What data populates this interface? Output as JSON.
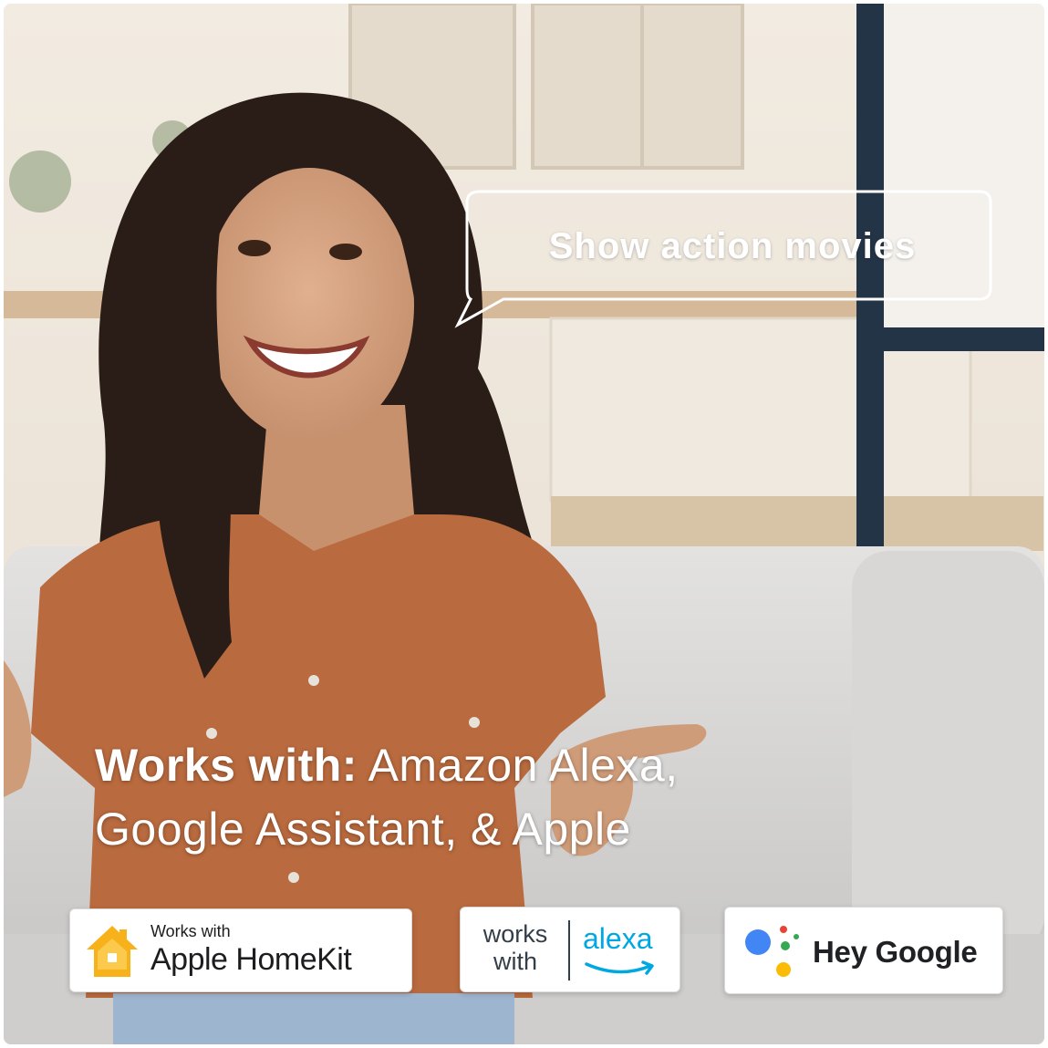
{
  "speech_bubble": {
    "text": "Show action movies"
  },
  "headline": {
    "bold": "Works with:",
    "line1_rest": "Amazon Alexa,",
    "line2": "Google Assistant, & Apple"
  },
  "badges": {
    "homekit": {
      "small": "Works with",
      "big": "Apple HomeKit"
    },
    "alexa": {
      "works": "works",
      "with": "with",
      "brand": "alexa"
    },
    "google": {
      "text": "Hey Google"
    }
  },
  "colors": {
    "alexa_blue": "#00a8e1",
    "homekit_orange": "#f7b21b",
    "google_blue": "#4285f4",
    "google_red": "#ea4335",
    "google_yellow": "#fbbc05",
    "google_green": "#34a853",
    "shirt": "#b96a3e",
    "sofa": "#d9d8d6",
    "window_frame": "#243447"
  },
  "icons": [
    "homekit-house-icon",
    "alexa-smile-arrow-icon",
    "google-assistant-dots-icon",
    "speech-bubble-icon"
  ]
}
